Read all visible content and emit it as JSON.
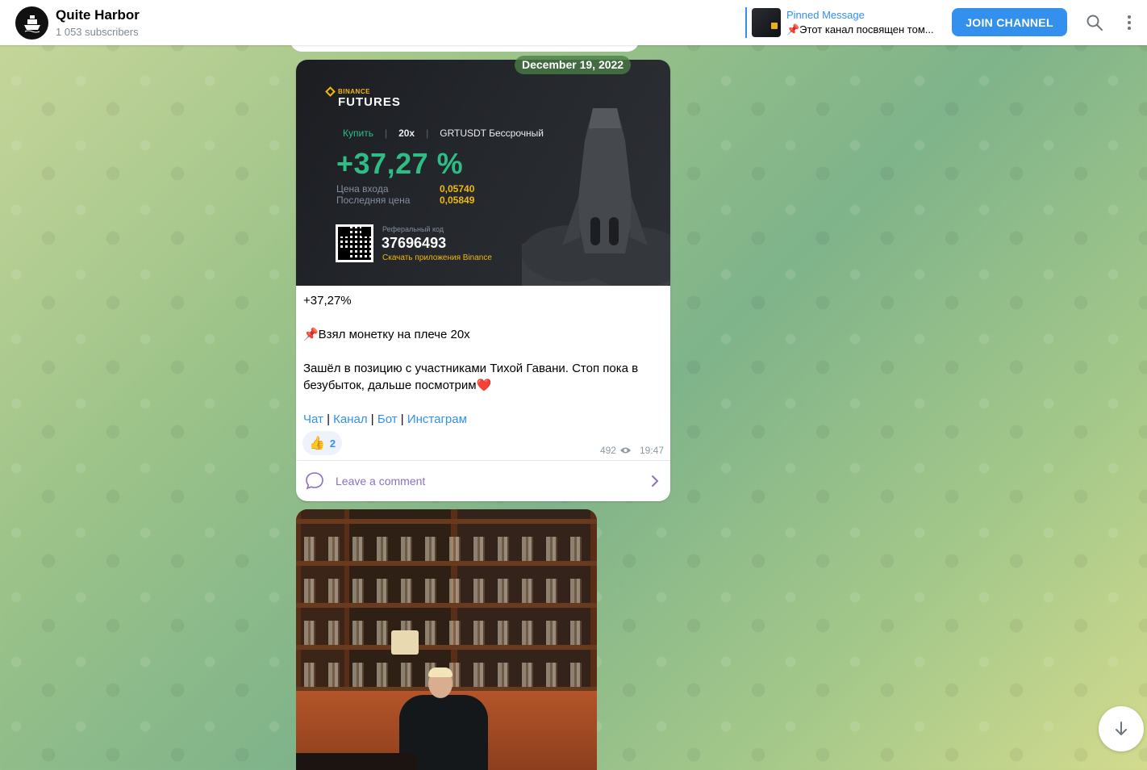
{
  "header": {
    "channel_name": "Quite Harbor",
    "subscribers": "1 053 subscribers",
    "pinned_title": "Pinned Message",
    "pinned_text": "📌Этот канал посвящен том...",
    "join_label": "JOIN CHANNEL",
    "search_icon": "search-icon",
    "more_icon": "more-vertical-icon"
  },
  "date_pill": "December 19, 2022",
  "post": {
    "media": {
      "brand_small": "BINANCE",
      "brand_big": "FUTURES",
      "side": "Купить",
      "leverage": "20x",
      "pair": "GRTUSDT Бессрочный",
      "pnl": "+37,27 %",
      "entry_label": "Цена входа",
      "entry_value": "0,05740",
      "last_label": "Последняя цена",
      "last_value": "0,05849",
      "ref_label": "Реферальный код",
      "ref_code": "37696493",
      "ref_link": "Скачать приложения Binance"
    },
    "line1": "+37,27%",
    "line2": "📌Взял монетку на плече 20х",
    "line3": "Зашёл в позицию с участниками Тихой  Гавани.  Стоп пока в безубыток, дальше посмотрим❤️",
    "links": [
      "Чат",
      "Канал",
      "Бот",
      "Инстаграм"
    ],
    "reaction_emoji": "👍",
    "reaction_count": "2",
    "views": "492",
    "time": "19:47",
    "comment_label": "Leave a comment"
  },
  "colors": {
    "accent": "#3390ec",
    "binance_yellow": "#f0b90b",
    "binance_green": "#2ebd85",
    "comment_purple": "#8b6fc7"
  }
}
